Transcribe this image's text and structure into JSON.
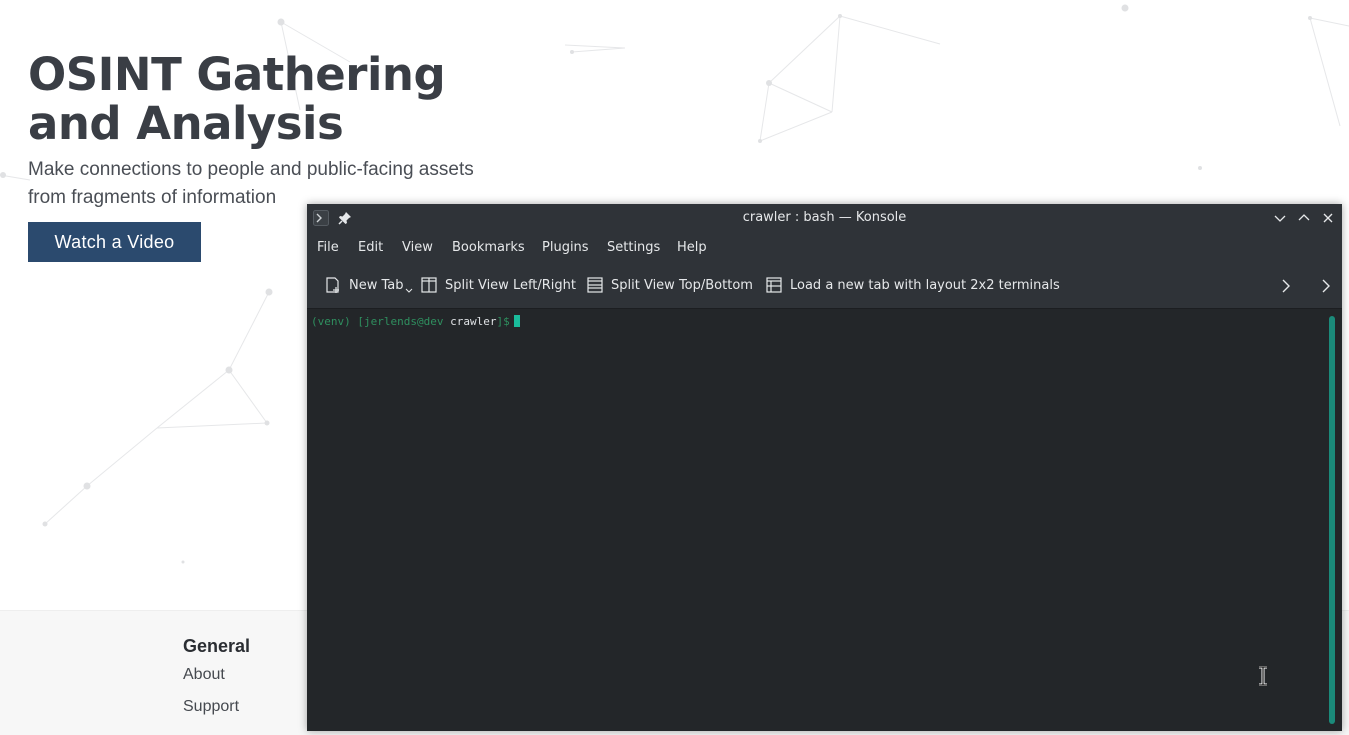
{
  "hero": {
    "title_line1": "OSINT Gathering",
    "title_line2": "and Analysis",
    "subtitle_line1": "Make connections to people and public-facing assets",
    "subtitle_line2": "from fragments of information",
    "cta_label": "Watch a Video"
  },
  "footer": {
    "heading": "General",
    "links": [
      "About",
      "Support"
    ]
  },
  "konsole": {
    "title": "crawler : bash — Konsole",
    "menu": [
      "File",
      "Edit",
      "View",
      "Bookmarks",
      "Plugins",
      "Settings",
      "Help"
    ],
    "toolbar": {
      "new_tab": "New Tab",
      "split_lr": "Split View Left/Right",
      "split_tb": "Split View Top/Bottom",
      "load_layout": "Load a new tab with layout 2x2 terminals"
    },
    "terminal": {
      "venv": "(venv)",
      "user_host": "[jerlends@dev",
      "dir": "crawler",
      "prompt_end": "]$"
    }
  },
  "colors": {
    "cta_bg": "#2b4a6e",
    "window_bg": "#232629",
    "chrome_bg": "#2f3338",
    "accent": "#1abc9c",
    "prompt_green": "#2f8f5f"
  }
}
